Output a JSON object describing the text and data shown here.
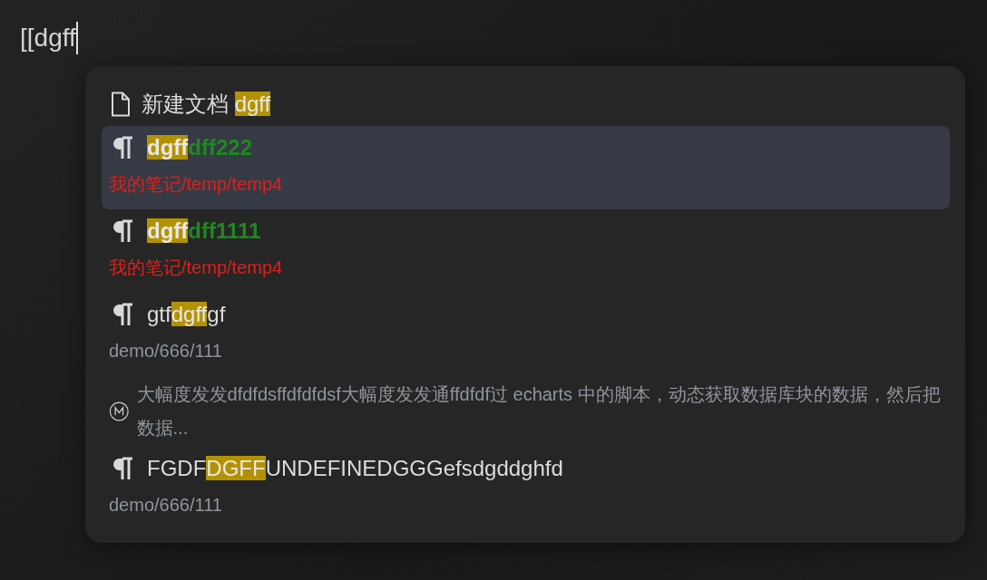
{
  "editor": {
    "value": "[[dgff"
  },
  "suggestions": [
    {
      "kind": "create",
      "selected": false,
      "label": "新建文档 ",
      "query": "dgff"
    },
    {
      "kind": "block",
      "selected": true,
      "styled": true,
      "title": [
        {
          "text": "dgff",
          "match": true
        },
        {
          "text": "dff222",
          "match": false
        }
      ],
      "path": "我的笔记/temp/temp4"
    },
    {
      "kind": "block",
      "selected": false,
      "styled": true,
      "title": [
        {
          "text": "dgff",
          "match": true
        },
        {
          "text": "dff1111",
          "match": false
        }
      ],
      "path": "我的笔记/temp/temp4"
    },
    {
      "kind": "block",
      "selected": false,
      "styled": false,
      "title": [
        {
          "text": "gtf",
          "match": false
        },
        {
          "text": "dgff",
          "match": true
        },
        {
          "text": "gf",
          "match": false
        }
      ],
      "path": "demo/666/111"
    },
    {
      "kind": "memo",
      "selected": false,
      "text": "大幅度发发dfdfdsffdfdfdsf大幅度发发通ffdfdf过 echarts 中的脚本，动态获取数据库块的数据，然后把数据..."
    },
    {
      "kind": "block",
      "selected": false,
      "styled": false,
      "title": [
        {
          "text": "FGDF",
          "match": false
        },
        {
          "text": "DGFF",
          "match": true
        },
        {
          "text": "UNDEFINEDGGGefsdgddghfd",
          "match": false
        }
      ],
      "path": "demo/666/111"
    }
  ]
}
